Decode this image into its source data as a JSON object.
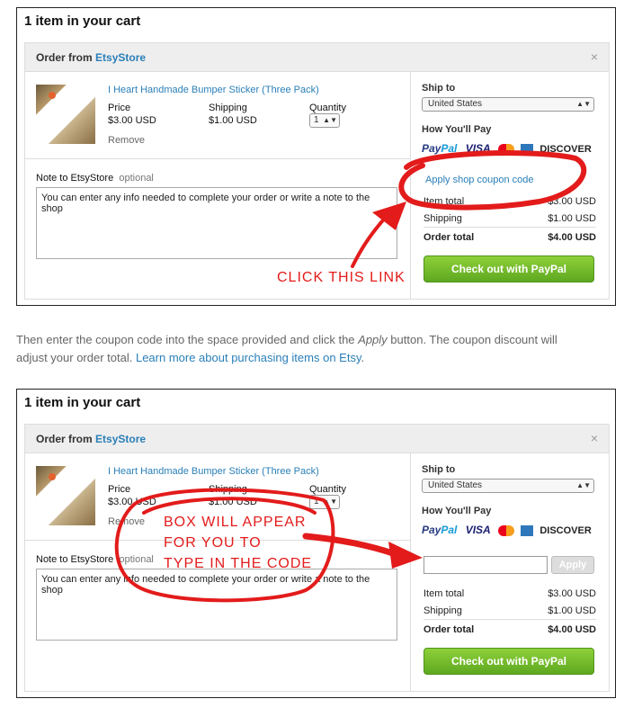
{
  "screens": [
    {
      "cart_title": "1 item in your cart",
      "order_from_label": "Order from",
      "shop_name": "EtsyStore",
      "close_symbol": "×",
      "item_name": "I Heart Handmade Bumper Sticker (Three Pack)",
      "price_label": "Price",
      "price_value": "$3.00 USD",
      "shipping_label": "Shipping",
      "shipping_value": "$1.00 USD",
      "quantity_label": "Quantity",
      "quantity_value": "1",
      "remove_label": "Remove",
      "note_label": "Note to EtsyStore",
      "note_optional": "optional",
      "note_text": "You can enter any info needed to complete your order or write a note to the shop",
      "ship_to_label": "Ship to",
      "ship_to_value": "United States",
      "pay_label": "How You'll Pay",
      "coupon_link": "Apply shop coupon code",
      "item_total_label": "Item total",
      "item_total_value": "$3.00 USD",
      "shipping_total_label": "Shipping",
      "shipping_total_value": "$1.00 USD",
      "order_total_label": "Order total",
      "order_total_value": "$4.00 USD",
      "checkout_label": "Check out with PayPal",
      "annotation": "CLICK THIS LINK"
    },
    {
      "cart_title": "1 item in your cart",
      "order_from_label": "Order from",
      "shop_name": "EtsyStore",
      "close_symbol": "×",
      "item_name": "I Heart Handmade Bumper Sticker (Three Pack)",
      "price_label": "Price",
      "price_value": "$3.00 USD",
      "shipping_label": "Shipping",
      "shipping_value": "$1.00 USD",
      "quantity_label": "Quantity",
      "quantity_value": "1",
      "remove_label": "Remove",
      "note_label": "Note to EtsyStore",
      "note_optional": "optional",
      "note_text": "You can enter any info needed to complete your order or write a note to the shop",
      "ship_to_label": "Ship to",
      "ship_to_value": "United States",
      "pay_label": "How You'll Pay",
      "apply_label": "Apply",
      "item_total_label": "Item total",
      "item_total_value": "$3.00 USD",
      "shipping_total_label": "Shipping",
      "shipping_total_value": "$1.00 USD",
      "order_total_label": "Order total",
      "order_total_value": "$4.00 USD",
      "checkout_label": "Check out with PayPal",
      "annotation_lines": [
        "BOX WILL APPEAR",
        "FOR YOU TO",
        "TYPE IN THE CODE"
      ]
    }
  ],
  "payment_logos": {
    "paypal_a": "Pay",
    "paypal_b": "Pal",
    "visa": "VISA",
    "discover": "DISCOVER",
    "mastercard_icon": "mastercard-icon",
    "amex_icon": "amex-icon"
  },
  "instructions": {
    "text_before_italic": "Then enter the coupon code into the space provided and click the ",
    "italic_word": "Apply",
    "text_after_italic": " button.  The coupon discount will adjust your order total. ",
    "link_text": "Learn more about purchasing items on Etsy",
    "text_end": "."
  },
  "colors": {
    "link": "#2a7fb8",
    "annotation_red": "#e31b1b",
    "checkout_green": "#6bb827"
  }
}
